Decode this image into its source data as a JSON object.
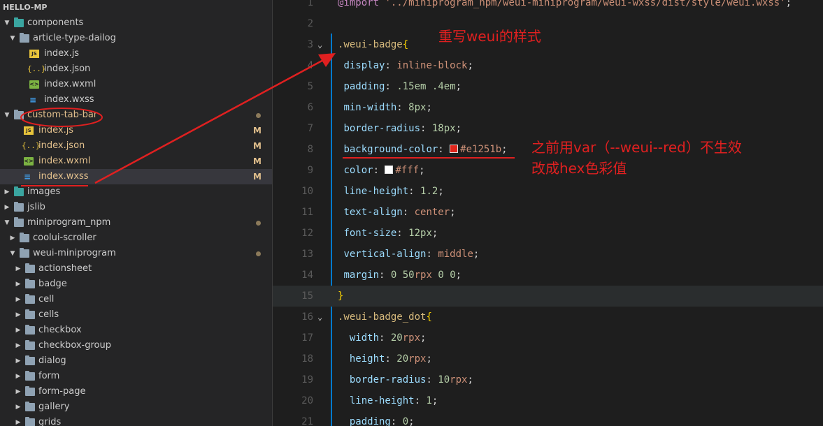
{
  "sidebar": {
    "section_title": "HELLO-MP",
    "tree": [
      {
        "label": "components",
        "type": "folder-open",
        "depth": 0,
        "icon": "folder-teal-icon"
      },
      {
        "label": "article-type-dailog",
        "type": "folder-open",
        "depth": 1,
        "icon": "folder-icon"
      },
      {
        "label": "index.js",
        "type": "js",
        "depth": 2
      },
      {
        "label": "index.json",
        "type": "json",
        "depth": 2
      },
      {
        "label": "index.wxml",
        "type": "wxml",
        "depth": 2
      },
      {
        "label": "index.wxss",
        "type": "wxss",
        "depth": 2
      },
      {
        "label": "custom-tab-bar",
        "type": "folder-open",
        "depth": 0,
        "modified": true,
        "dot": true
      },
      {
        "label": "index.js",
        "type": "js",
        "depth": 1,
        "modified": true,
        "status": "M"
      },
      {
        "label": "index.json",
        "type": "json",
        "depth": 1,
        "modified": true,
        "status": "M"
      },
      {
        "label": "index.wxml",
        "type": "wxml",
        "depth": 1,
        "modified": true,
        "status": "M"
      },
      {
        "label": "index.wxss",
        "type": "wxss",
        "depth": 1,
        "modified": true,
        "status": "M",
        "selected": true
      },
      {
        "label": "images",
        "type": "folder-closed",
        "depth": 0,
        "teal": true
      },
      {
        "label": "jslib",
        "type": "folder-closed",
        "depth": 0
      },
      {
        "label": "miniprogram_npm",
        "type": "folder-open",
        "depth": 0,
        "dot": true
      },
      {
        "label": "coolui-scroller",
        "type": "folder-closed",
        "depth": 1
      },
      {
        "label": "weui-miniprogram",
        "type": "folder-open",
        "depth": 1,
        "dot": true
      },
      {
        "label": "actionsheet",
        "type": "folder-closed",
        "depth": 2
      },
      {
        "label": "badge",
        "type": "folder-closed",
        "depth": 2
      },
      {
        "label": "cell",
        "type": "folder-closed",
        "depth": 2
      },
      {
        "label": "cells",
        "type": "folder-closed",
        "depth": 2
      },
      {
        "label": "checkbox",
        "type": "folder-closed",
        "depth": 2
      },
      {
        "label": "checkbox-group",
        "type": "folder-closed",
        "depth": 2
      },
      {
        "label": "dialog",
        "type": "folder-closed",
        "depth": 2
      },
      {
        "label": "form",
        "type": "folder-closed",
        "depth": 2
      },
      {
        "label": "form-page",
        "type": "folder-closed",
        "depth": 2
      },
      {
        "label": "gallery",
        "type": "folder-closed",
        "depth": 2
      },
      {
        "label": "grids",
        "type": "folder-closed",
        "depth": 2
      }
    ]
  },
  "editor": {
    "lines": [
      {
        "n": "1",
        "code": [
          [
            "t-at",
            "@import"
          ],
          [
            "t-punc",
            " "
          ],
          [
            "t-str",
            "'../miniprogram_npm/weui-miniprogram/weui-wxss/dist/style/weui.wxss'"
          ],
          [
            "t-punc",
            ";"
          ]
        ]
      },
      {
        "n": "2",
        "code": []
      },
      {
        "n": "3",
        "fold": true,
        "code": [
          [
            "t-sel",
            ".weui-badge"
          ],
          [
            "t-brace",
            "{"
          ]
        ]
      },
      {
        "n": "4",
        "code": [
          [
            "t-punc",
            " "
          ],
          [
            "t-prop",
            "display"
          ],
          [
            "t-punc",
            ": "
          ],
          [
            "t-val",
            "inline-block"
          ],
          [
            "t-punc",
            ";"
          ]
        ]
      },
      {
        "n": "5",
        "code": [
          [
            "t-punc",
            " "
          ],
          [
            "t-prop",
            "padding"
          ],
          [
            "t-punc",
            ": "
          ],
          [
            "t-num",
            ".15em"
          ],
          [
            "t-punc",
            " "
          ],
          [
            "t-num",
            ".4em"
          ],
          [
            "t-punc",
            ";"
          ]
        ]
      },
      {
        "n": "6",
        "code": [
          [
            "t-punc",
            " "
          ],
          [
            "t-prop",
            "min-width"
          ],
          [
            "t-punc",
            ": "
          ],
          [
            "t-num",
            "8px"
          ],
          [
            "t-punc",
            ";"
          ]
        ]
      },
      {
        "n": "7",
        "code": [
          [
            "t-punc",
            " "
          ],
          [
            "t-prop",
            "border-radius"
          ],
          [
            "t-punc",
            ": "
          ],
          [
            "t-num",
            "18px"
          ],
          [
            "t-punc",
            ";"
          ]
        ]
      },
      {
        "n": "8",
        "code": [
          [
            "t-punc",
            " "
          ],
          [
            "t-prop",
            "background-color"
          ],
          [
            "t-punc",
            ": "
          ],
          [
            "swatch",
            "#e1251b"
          ],
          [
            "t-val",
            "#e1251b"
          ],
          [
            "t-punc",
            ";"
          ]
        ]
      },
      {
        "n": "9",
        "code": [
          [
            "t-punc",
            " "
          ],
          [
            "t-prop",
            "color"
          ],
          [
            "t-punc",
            ": "
          ],
          [
            "swatch",
            "#ffffff"
          ],
          [
            "t-val",
            "#fff"
          ],
          [
            "t-punc",
            ";"
          ]
        ]
      },
      {
        "n": "10",
        "code": [
          [
            "t-punc",
            " "
          ],
          [
            "t-prop",
            "line-height"
          ],
          [
            "t-punc",
            ": "
          ],
          [
            "t-num",
            "1.2"
          ],
          [
            "t-punc",
            ";"
          ]
        ]
      },
      {
        "n": "11",
        "code": [
          [
            "t-punc",
            " "
          ],
          [
            "t-prop",
            "text-align"
          ],
          [
            "t-punc",
            ": "
          ],
          [
            "t-val",
            "center"
          ],
          [
            "t-punc",
            ";"
          ]
        ]
      },
      {
        "n": "12",
        "code": [
          [
            "t-punc",
            " "
          ],
          [
            "t-prop",
            "font-size"
          ],
          [
            "t-punc",
            ": "
          ],
          [
            "t-num",
            "12px"
          ],
          [
            "t-punc",
            ";"
          ]
        ]
      },
      {
        "n": "13",
        "code": [
          [
            "t-punc",
            " "
          ],
          [
            "t-prop",
            "vertical-align"
          ],
          [
            "t-punc",
            ": "
          ],
          [
            "t-val",
            "middle"
          ],
          [
            "t-punc",
            ";"
          ]
        ]
      },
      {
        "n": "14",
        "code": [
          [
            "t-punc",
            " "
          ],
          [
            "t-prop",
            "margin"
          ],
          [
            "t-punc",
            ": "
          ],
          [
            "t-num",
            "0"
          ],
          [
            "t-punc",
            " "
          ],
          [
            "t-num",
            "50"
          ],
          [
            "t-val",
            "rpx"
          ],
          [
            "t-punc",
            " "
          ],
          [
            "t-num",
            "0"
          ],
          [
            "t-punc",
            " "
          ],
          [
            "t-num",
            "0"
          ],
          [
            "t-punc",
            ";"
          ]
        ]
      },
      {
        "n": "15",
        "current": true,
        "code": [
          [
            "t-brace",
            "}"
          ]
        ]
      },
      {
        "n": "16",
        "fold": true,
        "code": [
          [
            "t-sel",
            ".weui-badge_dot"
          ],
          [
            "t-brace",
            "{"
          ]
        ]
      },
      {
        "n": "17",
        "code": [
          [
            "t-punc",
            "  "
          ],
          [
            "t-prop",
            "width"
          ],
          [
            "t-punc",
            ": "
          ],
          [
            "t-num",
            "20"
          ],
          [
            "t-val",
            "rpx"
          ],
          [
            "t-punc",
            ";"
          ]
        ]
      },
      {
        "n": "18",
        "code": [
          [
            "t-punc",
            "  "
          ],
          [
            "t-prop",
            "height"
          ],
          [
            "t-punc",
            ": "
          ],
          [
            "t-num",
            "20"
          ],
          [
            "t-val",
            "rpx"
          ],
          [
            "t-punc",
            ";"
          ]
        ]
      },
      {
        "n": "19",
        "code": [
          [
            "t-punc",
            "  "
          ],
          [
            "t-prop",
            "border-radius"
          ],
          [
            "t-punc",
            ": "
          ],
          [
            "t-num",
            "10"
          ],
          [
            "t-val",
            "rpx"
          ],
          [
            "t-punc",
            ";"
          ]
        ]
      },
      {
        "n": "20",
        "code": [
          [
            "t-punc",
            "  "
          ],
          [
            "t-prop",
            "line-height"
          ],
          [
            "t-punc",
            ": "
          ],
          [
            "t-num",
            "1"
          ],
          [
            "t-punc",
            ";"
          ]
        ]
      },
      {
        "n": "21",
        "code": [
          [
            "t-punc",
            "  "
          ],
          [
            "t-prop",
            "padding"
          ],
          [
            "t-punc",
            ": "
          ],
          [
            "t-num",
            "0"
          ],
          [
            "t-punc",
            ";"
          ]
        ]
      }
    ]
  },
  "annotations": {
    "title": "重写weui的样式",
    "note_line1": "之前用var（--weui--red）不生效",
    "note_line2": "改成hex色彩值",
    "color": "#e02020"
  }
}
